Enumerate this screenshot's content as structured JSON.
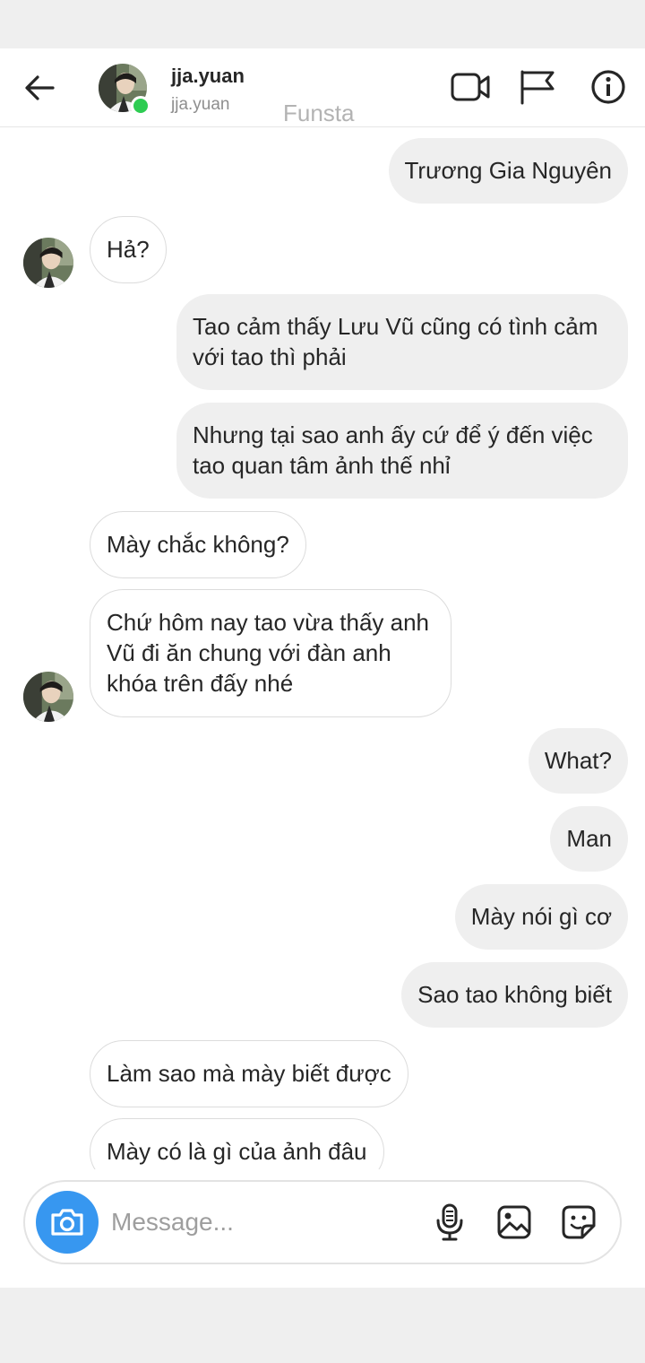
{
  "header": {
    "username": "jja.yuan",
    "handle": "jja.yuan",
    "watermark": "Funsta"
  },
  "messages": [
    {
      "dir": "out",
      "text": "Trương Gia Nguyên"
    },
    {
      "dir": "in",
      "text": "Hả?"
    },
    {
      "dir": "out",
      "text": "Tao cảm thấy Lưu Vũ cũng có tình cảm với tao thì phải"
    },
    {
      "dir": "out",
      "text": "Nhưng tại sao anh ấy cứ để ý đến việc tao quan tâm ảnh thế nhỉ"
    },
    {
      "dir": "in",
      "text": "Mày chắc không?"
    },
    {
      "dir": "in",
      "text": "Chứ hôm nay tao vừa thấy anh Vũ đi ăn chung với đàn anh khóa trên đấy nhé"
    },
    {
      "dir": "out",
      "text": "What?"
    },
    {
      "dir": "out",
      "text": "Man"
    },
    {
      "dir": "out",
      "text": "Mày nói gì cơ"
    },
    {
      "dir": "out",
      "text": "Sao tao không biết"
    },
    {
      "dir": "in",
      "text": "Làm sao mà mày biết được"
    },
    {
      "dir": "in",
      "text": "Mày có là gì của ảnh đâu"
    }
  ],
  "composer": {
    "placeholder": "Message..."
  },
  "icons": {
    "back": "arrow-left-icon",
    "video": "video-camera-icon",
    "flag": "flag-icon",
    "info": "info-icon",
    "camera": "camera-icon",
    "mic": "microphone-icon",
    "gallery": "image-icon",
    "sticker": "sticker-icon"
  },
  "colors": {
    "accent": "#3797f0",
    "online": "#2ecc52",
    "outgoing_bubble": "#efefef"
  }
}
